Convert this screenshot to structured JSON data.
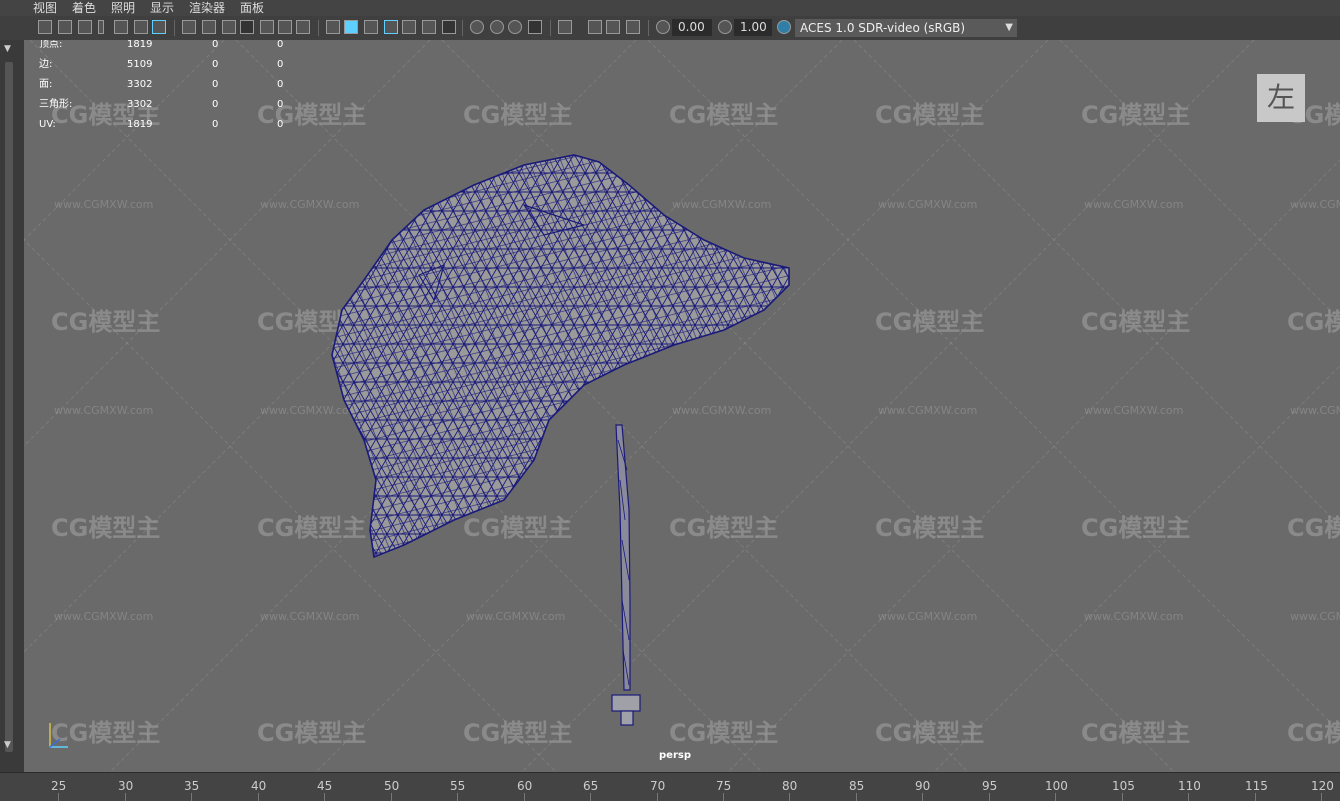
{
  "menu": [
    "视图",
    "着色",
    "照明",
    "显示",
    "渲染器",
    "面板"
  ],
  "toolbar": {
    "exposure": "0.00",
    "gamma": "1.00",
    "color_space": "ACES 1.0 SDR-video (sRGB)",
    "icons": [
      "camera-icon",
      "camera-attributes-icon",
      "bookmark-icon",
      "image-plane-icon",
      "grid-icon",
      "film-gate-icon",
      "resolution-gate-icon",
      "safe-area-icon",
      "field-chart-icon",
      "wireframe-icon",
      "smooth-shade-icon",
      "flat-shade-icon",
      "wireframe-on-shaded-icon",
      "textured-icon",
      "lights-icon",
      "shadows-icon",
      "ambient-occlusion-icon",
      "motion-blur-icon",
      "anti-aliasing-icon",
      "xray-icon",
      "isolate-select-icon",
      "exposure-icon",
      "gamma-icon",
      "color-management-icon"
    ]
  },
  "hud": {
    "rows": [
      {
        "label": "顶点:",
        "v1": "1819",
        "v2": "0",
        "v3": "0"
      },
      {
        "label": "边:",
        "v1": "5109",
        "v2": "0",
        "v3": "0"
      },
      {
        "label": "面:",
        "v1": "3302",
        "v2": "0",
        "v3": "0"
      },
      {
        "label": "三角形:",
        "v1": "3302",
        "v2": "0",
        "v3": "0"
      },
      {
        "label": "UV:",
        "v1": "1819",
        "v2": "0",
        "v3": "0"
      }
    ]
  },
  "view_cube": "左",
  "camera_name": "persp",
  "watermark": {
    "logo": "CG模型主",
    "url": "www.CGMXW.com"
  },
  "timeline": [
    "25",
    "30",
    "35",
    "40",
    "45",
    "50",
    "55",
    "60",
    "65",
    "70",
    "75",
    "80",
    "85",
    "90",
    "95",
    "100",
    "105",
    "110",
    "115",
    "120"
  ],
  "colors": {
    "viewport_bg": "#6a6a6a",
    "wire": "#1a1a7a",
    "mesh_fill": "#9a9a9a",
    "accent": "#5ecfff"
  }
}
